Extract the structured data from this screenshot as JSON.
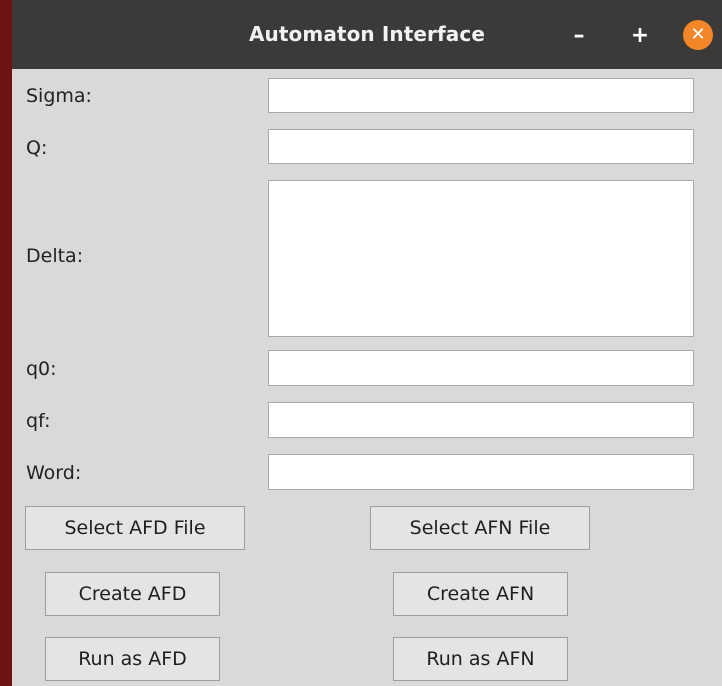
{
  "window": {
    "title": "Automaton Interface",
    "controls": {
      "minimize": "–",
      "maximize": "+",
      "close": "✕"
    }
  },
  "form": {
    "sigma_label": "Sigma:",
    "sigma_value": "",
    "q_label": "Q:",
    "q_value": "",
    "delta_label": "Delta:",
    "delta_value": "",
    "q0_label": "q0:",
    "q0_value": "",
    "qf_label": "qf:",
    "qf_value": "",
    "word_label": "Word:",
    "word_value": ""
  },
  "buttons": {
    "select_afd": "Select AFD File",
    "select_afn": "Select AFN File",
    "create_afd": "Create AFD",
    "create_afn": "Create AFN",
    "run_afd": "Run as AFD",
    "run_afn": "Run as AFN"
  }
}
